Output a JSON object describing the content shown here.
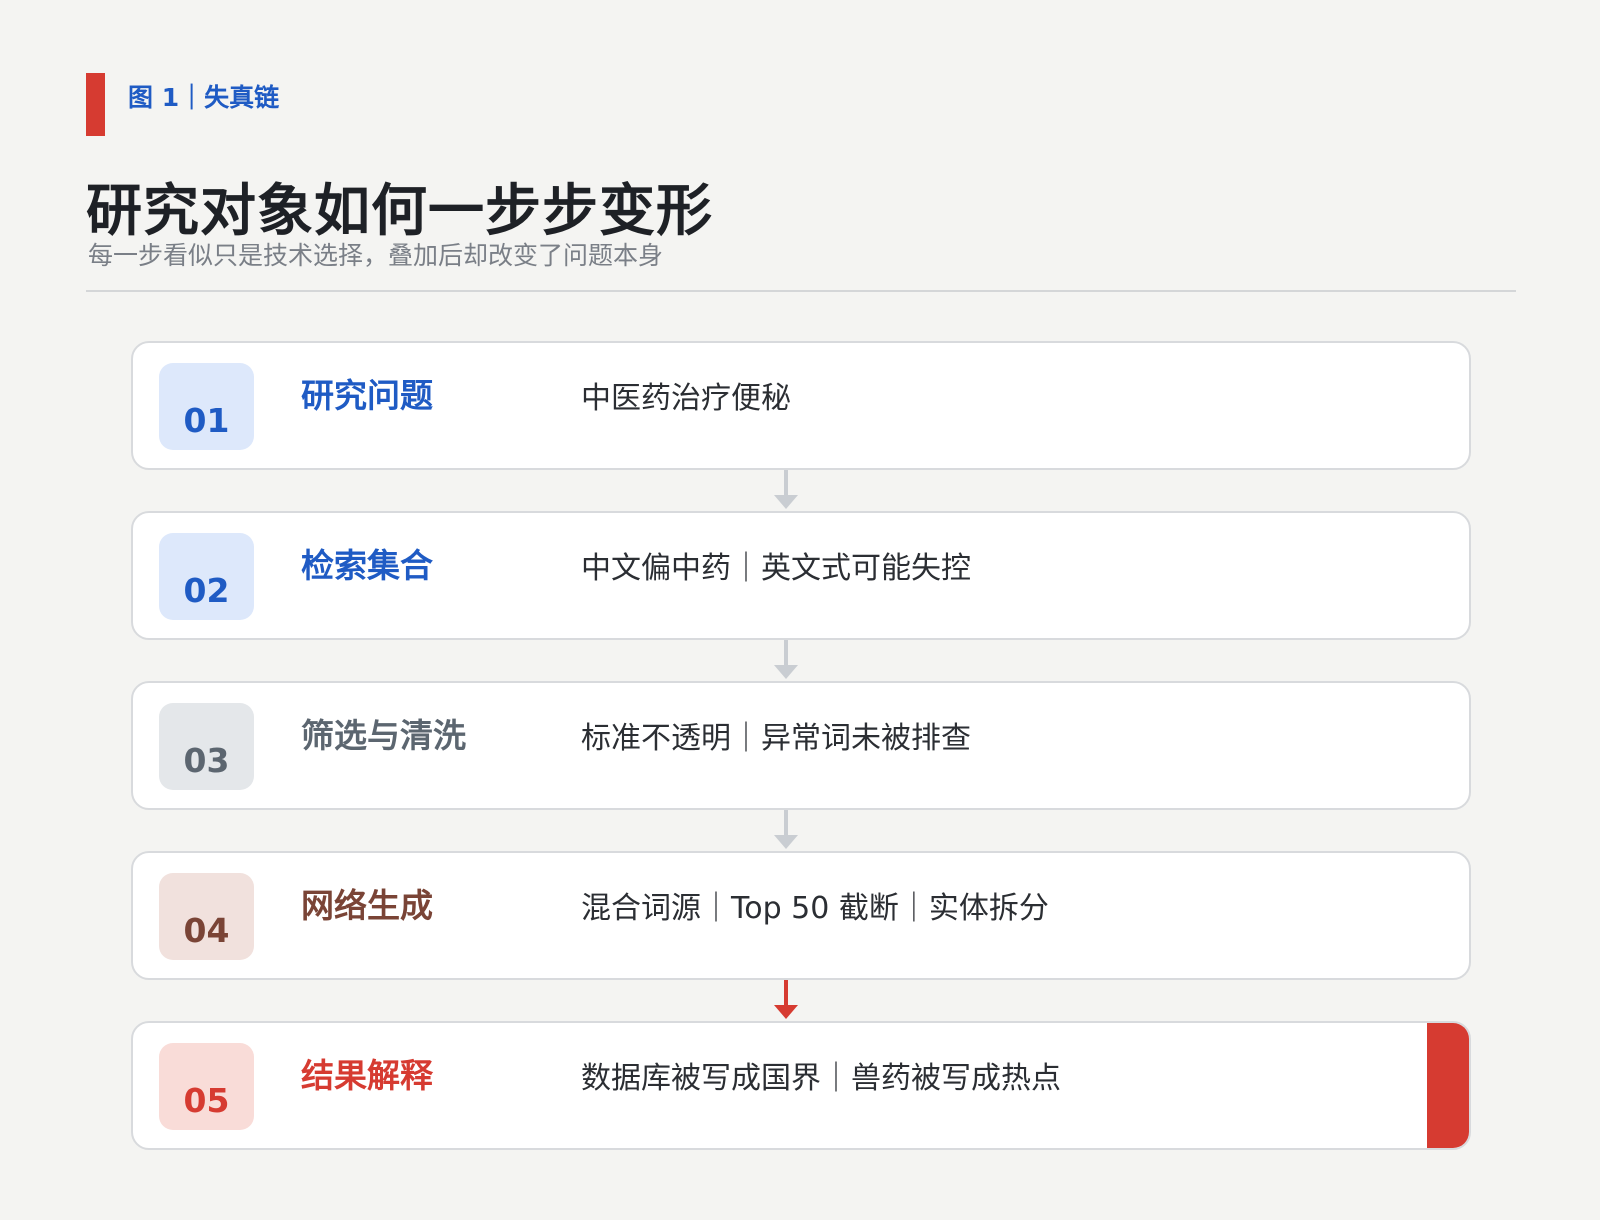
{
  "figure_label": "图 1｜失真链",
  "title": "研究对象如何一步步变形",
  "subtitle": "每一步看似只是技术选择，叠加后却改变了问题本身",
  "colors": {
    "accent_red": "#d63b31",
    "blue": "#1f5bc4",
    "gray": "#5c6670",
    "brown": "#7a4436",
    "red_text": "#d63b31",
    "arrow_gray": "#c9cdd2"
  },
  "steps": [
    {
      "num": "01",
      "title": "研究问题",
      "desc": "中医药治疗便秘",
      "tone": "blue",
      "badge_bg": "#dde8fb",
      "text_color": "#1f5bc4"
    },
    {
      "num": "02",
      "title": "检索集合",
      "desc": "中文偏中药｜英文式可能失控",
      "tone": "blue",
      "badge_bg": "#dde8fb",
      "text_color": "#1f5bc4"
    },
    {
      "num": "03",
      "title": "筛选与清洗",
      "desc": "标准不透明｜异常词未被排查",
      "tone": "gray",
      "badge_bg": "#e4e7ea",
      "text_color": "#5c6670"
    },
    {
      "num": "04",
      "title": "网络生成",
      "desc": "混合词源｜Top 50 截断｜实体拆分",
      "tone": "brown",
      "badge_bg": "#f1e1dd",
      "text_color": "#7a4436"
    },
    {
      "num": "05",
      "title": "结果解释",
      "desc": "数据库被写成国界｜兽药被写成热点",
      "tone": "red",
      "badge_bg": "#f9dcd8",
      "text_color": "#d63b31"
    }
  ],
  "connectors": [
    {
      "color": "#c9cdd2",
      "icon": "arrow-down"
    },
    {
      "color": "#c9cdd2",
      "icon": "arrow-down"
    },
    {
      "color": "#c9cdd2",
      "icon": "arrow-down"
    },
    {
      "color": "#d63b31",
      "icon": "arrow-down"
    }
  ]
}
